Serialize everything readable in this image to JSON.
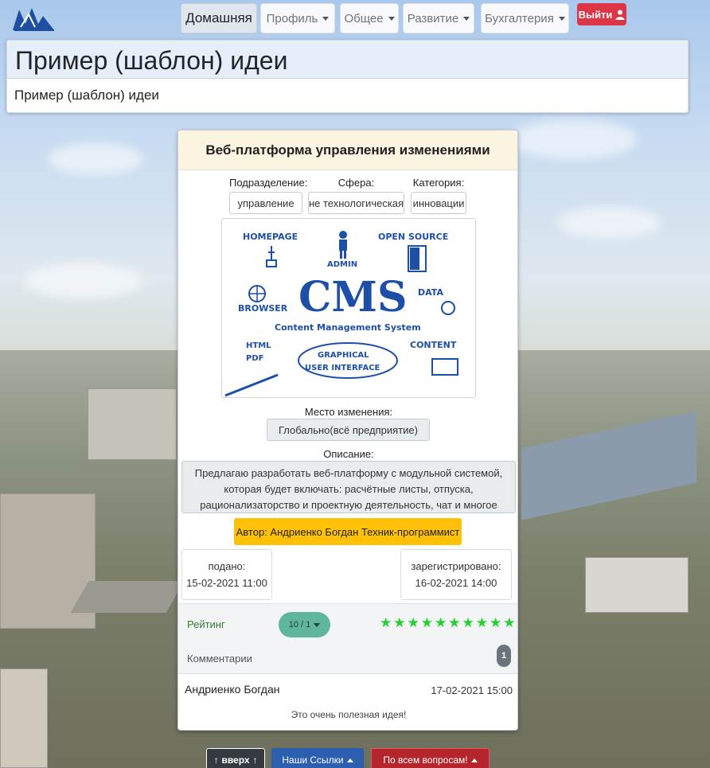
{
  "nav": {
    "home": "Домашняя",
    "profile": "Профиль",
    "general": "Общее",
    "development": "Развитие",
    "accounting": "Бухгалтерия",
    "logout": "Выйти"
  },
  "header": {
    "title": "Пример (шаблон) идеи",
    "subtitle": "Пример (шаблон) идеи"
  },
  "idea": {
    "title": "Веб-платформа управления изменениями",
    "fields": [
      {
        "label": "Подразделение:",
        "value": "управление"
      },
      {
        "label": "Сфера:",
        "value": "не технологическая"
      },
      {
        "label": "Категория:",
        "value": "инновации"
      }
    ],
    "image": {
      "homepage": "HOMEPAGE",
      "admin": "ADMIN",
      "open_source": "OPEN SOURCE",
      "browser": "BROWSER",
      "cms": "CMS",
      "data": "DATA",
      "cms_full": "Content Management System",
      "html": "HTML",
      "pdf": "PDF",
      "gui_line1": "GRAPHICAL",
      "gui_line2": "USER INTERFACE",
      "content": "CONTENT"
    },
    "place_label": "Место изменения:",
    "place_value": "Глобально(всё предприятие)",
    "desc_label": "Описание:",
    "description": "Предлагаю разработать веб-платформу с модульной системой, которая будет включать: расчётные листы, отпуска, рационализаторство и проектную деятельность, чат и многое другое.",
    "author": "Автор: Андриенко Богдан Техник-программист",
    "submitted_label": "подано:",
    "submitted_date": "15-02-2021 11:00",
    "registered_label": "зарегистрировано:",
    "registered_date": "16-02-2021 14:00",
    "rating_label": "Рейтинг",
    "rating_value": "10 / 1",
    "stars_filled": 10,
    "comments_label": "Комментарии",
    "comments_count": "1",
    "comment": {
      "author": "Андриенко Богдан",
      "date": "17-02-2021 15:00",
      "text": "Это очень полезная идея!"
    }
  },
  "footer": {
    "up": "вверх",
    "links": "Наши Ссылки",
    "ask": "По всем вопросам!"
  },
  "colors": {
    "logout": "#dc3545",
    "author_badge": "#ffc107",
    "rating_pill": "#5fb69b",
    "stars": "#22d12e"
  }
}
